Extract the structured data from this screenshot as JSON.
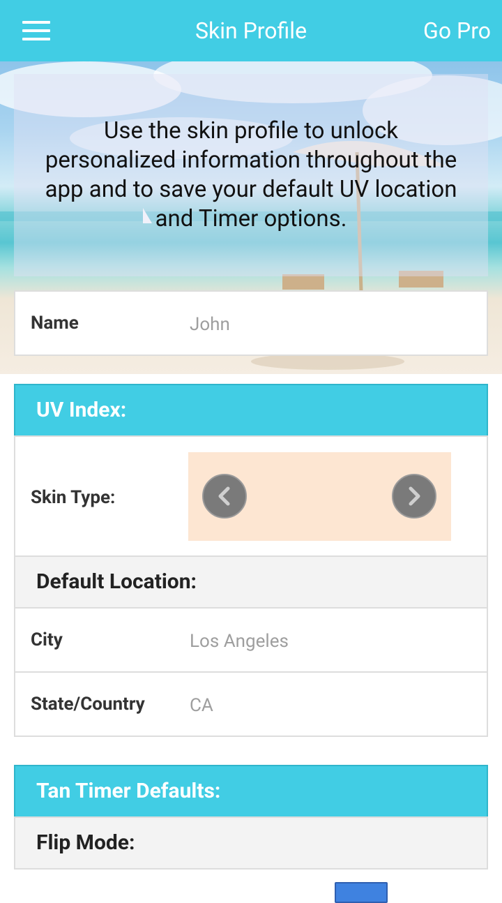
{
  "topbar": {
    "title": "Skin Profile",
    "go_pro": "Go Pro"
  },
  "hero": {
    "text": "Use the skin profile to unlock personalized information throughout the app and to save your default UV location and Timer options."
  },
  "name_row": {
    "label": "Name",
    "value": "John"
  },
  "uv_section": {
    "title": "UV Index:",
    "skin_type_label": "Skin Type:"
  },
  "location_section": {
    "title": "Default Location:",
    "city_label": "City",
    "city_value": "Los Angeles",
    "state_label": "State/Country",
    "state_value": "CA"
  },
  "tan_section": {
    "title": "Tan Timer Defaults:",
    "flip_mode_label": "Flip Mode:"
  },
  "colors": {
    "accent": "#41cde4",
    "skin_swatch": "#fde6d2",
    "button_blue": "#3f82e0"
  }
}
